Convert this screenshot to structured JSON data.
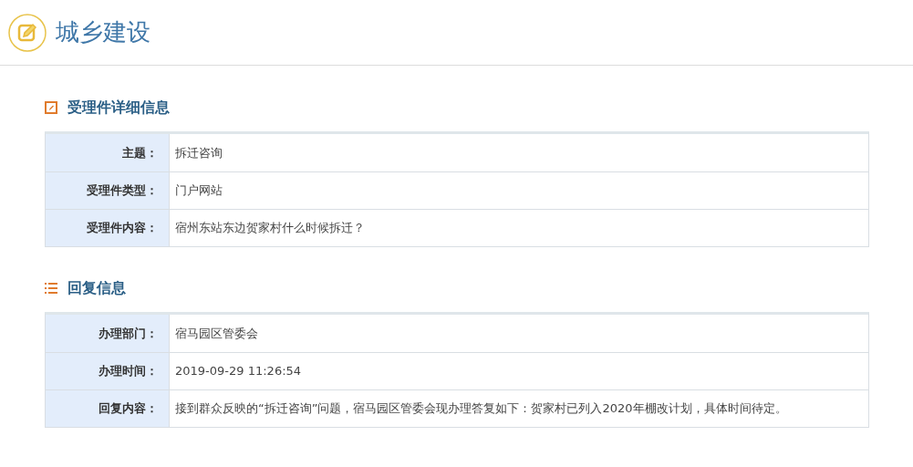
{
  "header": {
    "title": "城乡建设"
  },
  "sections": [
    {
      "kind": "edit",
      "title": "受理件详细信息",
      "rows": [
        {
          "label": "主题：",
          "value": "拆迁咨询"
        },
        {
          "label": "受理件类型：",
          "value": "门户网站"
        },
        {
          "label": "受理件内容：",
          "value": "宿州东站东边贺家村什么时候拆迁？"
        }
      ]
    },
    {
      "kind": "list",
      "title": "回复信息",
      "rows": [
        {
          "label": "办理部门：",
          "value": "宿马园区管委会"
        },
        {
          "label": "办理时间：",
          "value": "2019-09-29 11:26:54"
        },
        {
          "label": "回复内容：",
          "value": "接到群众反映的“拆迁咨询”问题，宿马园区管委会现办理答复如下：贺家村已列入2020年棚改计划，具体时间待定。"
        }
      ]
    }
  ]
}
